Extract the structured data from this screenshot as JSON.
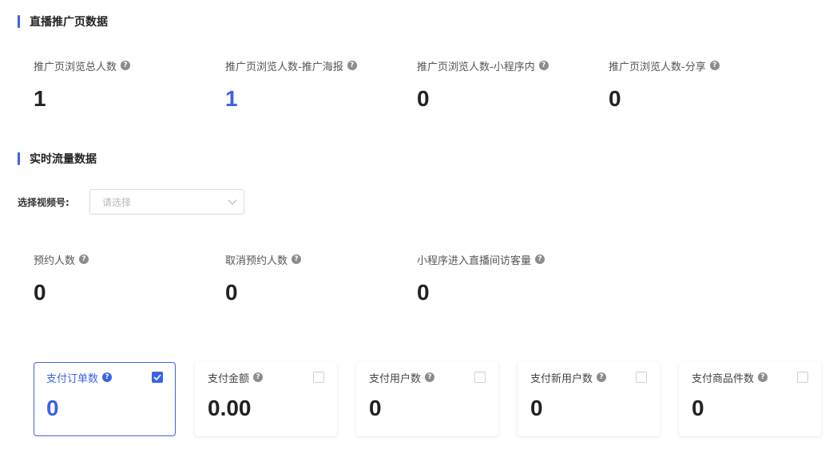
{
  "promo_section": {
    "title": "直播推广页数据",
    "metrics": [
      {
        "label": "推广页浏览总人数",
        "value": "1"
      },
      {
        "label": "推广页浏览人数-推广海报",
        "value": "1"
      },
      {
        "label": "推广页浏览人数-小程序内",
        "value": "0"
      },
      {
        "label": "推广页浏览人数-分享",
        "value": "0"
      }
    ]
  },
  "traffic_section": {
    "title": "实时流量数据",
    "select_label": "选择视频号:",
    "select_placeholder": "请选择",
    "metrics": [
      {
        "label": "预约人数",
        "value": "0"
      },
      {
        "label": "取消预约人数",
        "value": "0"
      },
      {
        "label": "小程序进入直播间访客量",
        "value": "0"
      }
    ]
  },
  "cards": [
    {
      "label": "支付订单数",
      "value": "0",
      "checked": true
    },
    {
      "label": "支付金额",
      "value": "0.00",
      "checked": false
    },
    {
      "label": "支付用户数",
      "value": "0",
      "checked": false
    },
    {
      "label": "支付新用户数",
      "value": "0",
      "checked": false
    },
    {
      "label": "支付商品件数",
      "value": "0",
      "checked": false
    }
  ],
  "colors": {
    "accent": "#3b63e6",
    "help_icon": "#8c8c8c"
  },
  "icons": {
    "help": "question-circle-icon",
    "check": "checkmark-icon",
    "dropdown": "chevron-down-icon"
  }
}
